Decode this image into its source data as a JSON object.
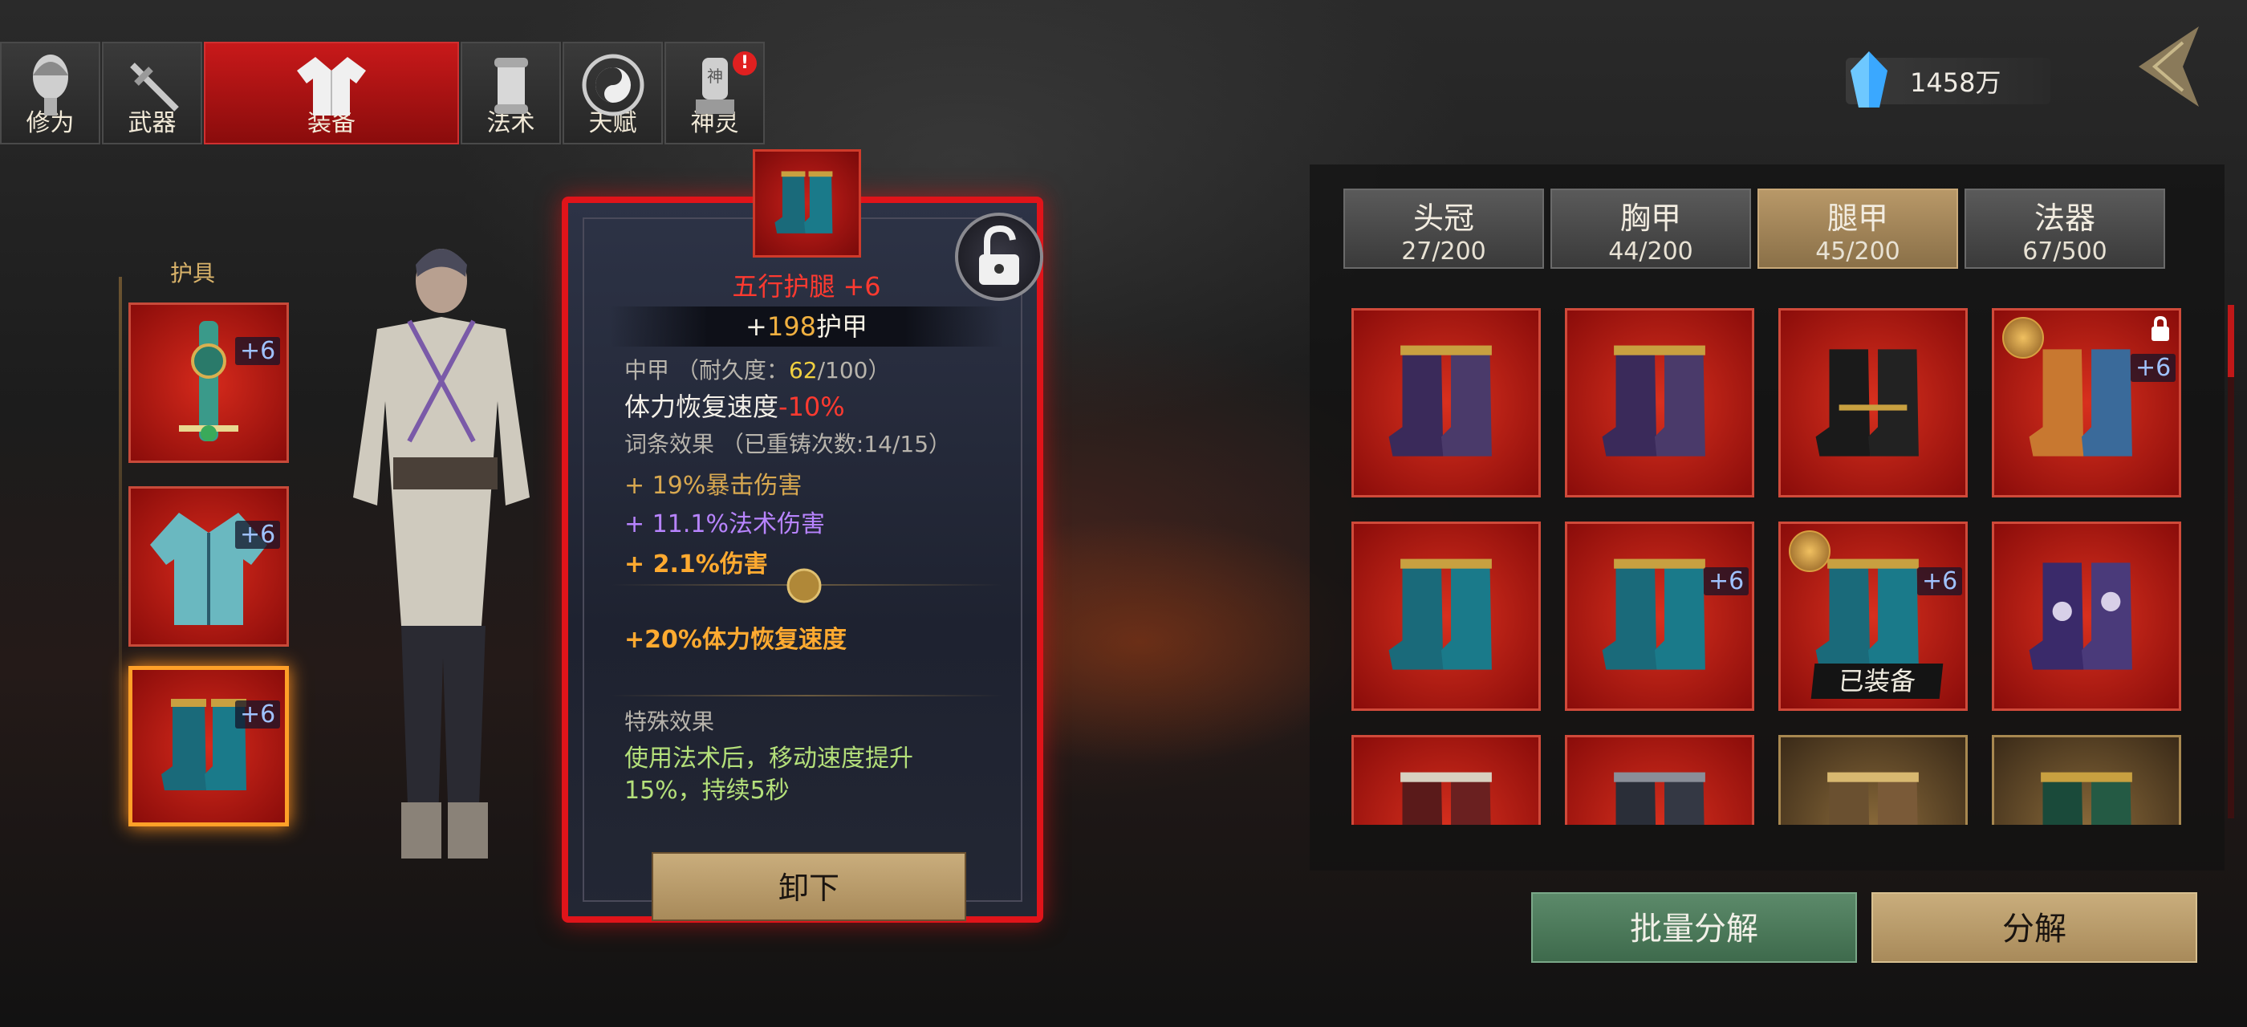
{
  "tabs": [
    {
      "label": "修为",
      "icon": "face-icon"
    },
    {
      "label": "武器",
      "icon": "sword-icon"
    },
    {
      "label": "装备",
      "icon": "robe-icon",
      "active": true
    },
    {
      "label": "法术",
      "icon": "scroll-icon"
    },
    {
      "label": "天赋",
      "icon": "bagua-icon"
    },
    {
      "label": "神灵",
      "icon": "shrine-icon",
      "badge": "!"
    }
  ],
  "currency": {
    "value": "1458万",
    "icon": "blue-crystal-icon"
  },
  "armor_column": {
    "label": "护具",
    "slots": [
      {
        "plus": "+6",
        "icon": "amulet-icon"
      },
      {
        "plus": "+6",
        "icon": "robe-armor-icon"
      },
      {
        "plus": "+6",
        "icon": "boots-icon",
        "selected": true
      }
    ]
  },
  "tooltip": {
    "name": "五行护腿 +6",
    "main_stat_prefix": "+",
    "main_stat_value": "198",
    "main_stat_suffix": "护甲",
    "armor_type": "中甲",
    "durability_label": "（耐久度：",
    "durability_current": "62",
    "durability_max": "/100）",
    "penalty_text": "体力恢复速度",
    "penalty_value": "-10%",
    "affix_title": "词条效果",
    "affix_count": "（已重铸次数:14/15）",
    "affix1_prefix": "+ 19%",
    "affix1_text": "暴击伤害",
    "affix2_prefix": "+ 11.1%",
    "affix2_text": "法术伤害",
    "affix3": "+ 2.1%伤害",
    "set_bonus": "+20%体力恢复速度",
    "special_title": "特殊效果",
    "special_line1": "使用法术后，移动速度提升",
    "special_line2": "15%，持续5秒",
    "unequip_label": "卸下"
  },
  "categories": [
    {
      "name": "头冠",
      "count": "27/200"
    },
    {
      "name": "胸甲",
      "count": "44/200"
    },
    {
      "name": "腿甲",
      "count": "45/200",
      "active": true
    },
    {
      "name": "法器",
      "count": "67/500"
    }
  ],
  "inventory": [
    {
      "style": "purple-gold-boots"
    },
    {
      "style": "purple-gold-boots"
    },
    {
      "style": "black-gold-boots"
    },
    {
      "style": "striped-boots",
      "plus": "+6",
      "coin": true,
      "locked": true
    },
    {
      "style": "teal-boots"
    },
    {
      "style": "teal-boots",
      "plus": "+6"
    },
    {
      "style": "teal-boots",
      "plus": "+6",
      "coin": true,
      "equipped_label": "已装备"
    },
    {
      "style": "purple-embroidered-boots"
    },
    {
      "style": "red-boots"
    },
    {
      "style": "dark-boots"
    },
    {
      "style": "gold-boots"
    },
    {
      "style": "green-boots"
    }
  ],
  "buttons": {
    "batch_disassemble": "批量分解",
    "disassemble": "分解"
  },
  "colors": {
    "accent_red": "#e0141a",
    "rare_plus": "#9fc2ff",
    "gold": "#d8a850"
  }
}
